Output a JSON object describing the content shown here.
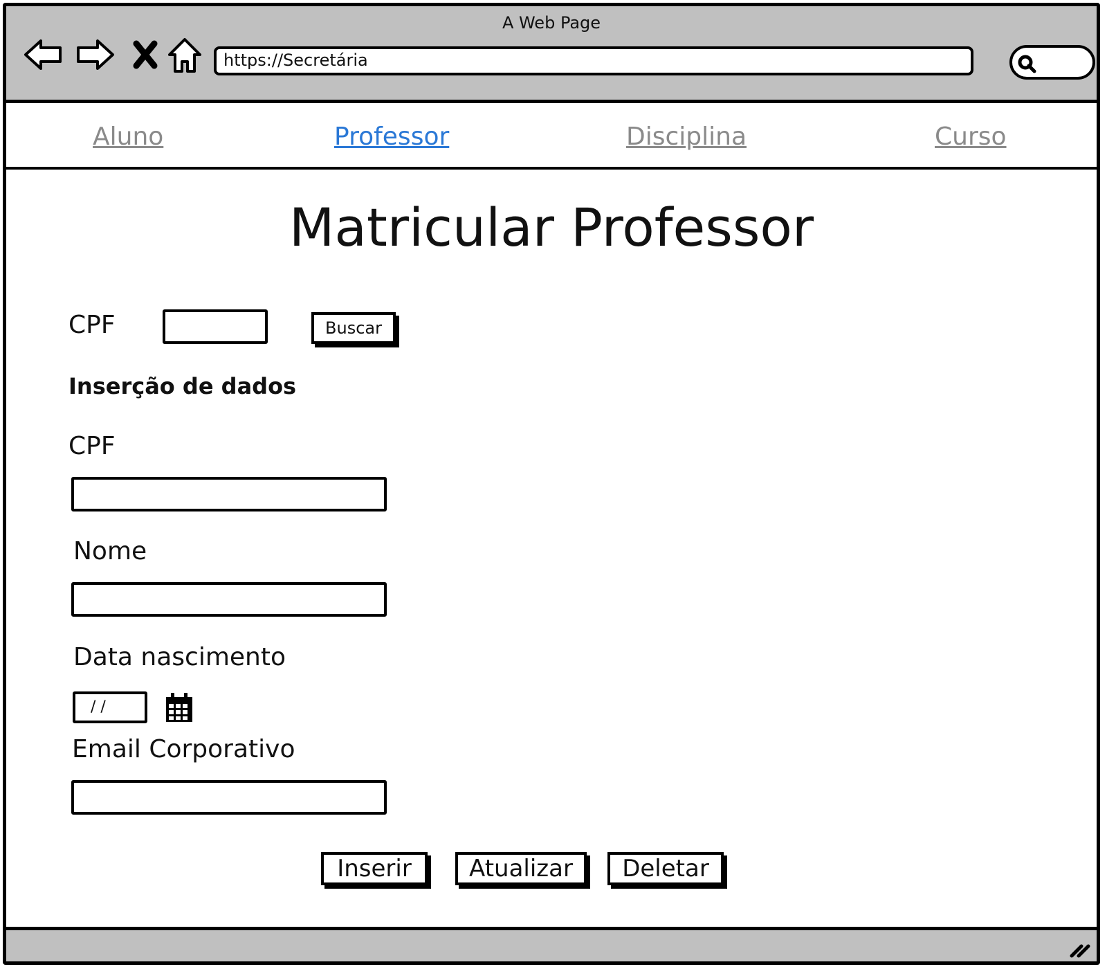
{
  "window": {
    "title": "A Web Page"
  },
  "browser": {
    "url": "https://Secretária"
  },
  "tabs": [
    {
      "label": "Aluno",
      "active": false
    },
    {
      "label": "Professor",
      "active": true
    },
    {
      "label": "Disciplina",
      "active": false
    },
    {
      "label": "Curso",
      "active": false
    }
  ],
  "page": {
    "title": "Matricular Professor"
  },
  "search_form": {
    "cpf_label": "CPF",
    "cpf_value": "",
    "button_label": "Buscar"
  },
  "data_form": {
    "section_title": "Inserção de dados",
    "cpf_label": "CPF",
    "cpf_value": "",
    "nome_label": "Nome",
    "nome_value": "",
    "data_label": "Data nascimento",
    "data_value": "/ /",
    "email_label": "Email Corporativo",
    "email_value": ""
  },
  "actions": {
    "insert": "Inserir",
    "update": "Atualizar",
    "delete": "Deletar"
  },
  "colors": {
    "chrome": "#c0c0c0",
    "active_tab": "#2a78d6",
    "inactive_tab": "#8a8a8a"
  },
  "icons": [
    "back-arrow-icon",
    "forward-arrow-icon",
    "stop-icon",
    "home-icon",
    "search-icon",
    "calendar-icon",
    "resize-grip-icon"
  ]
}
